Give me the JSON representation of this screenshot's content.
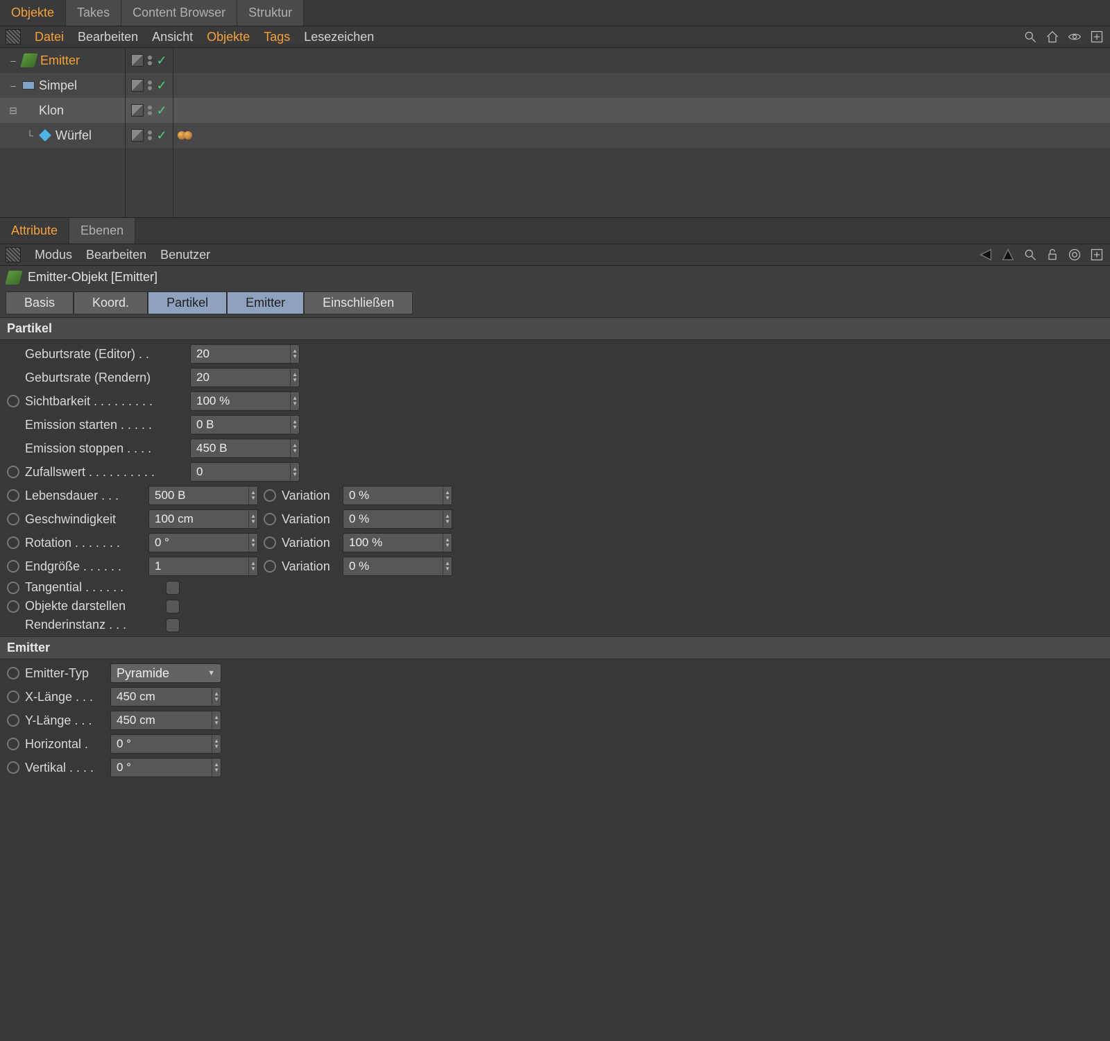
{
  "top_tabs": {
    "objekte": "Objekte",
    "takes": "Takes",
    "content": "Content Browser",
    "struktur": "Struktur"
  },
  "obj_menu": {
    "datei": "Datei",
    "bearbeiten": "Bearbeiten",
    "ansicht": "Ansicht",
    "objekte": "Objekte",
    "tags": "Tags",
    "lesezeichen": "Lesezeichen"
  },
  "tree": {
    "emitter": "Emitter",
    "simpel": "Simpel",
    "klon": "Klon",
    "wuerfel": "Würfel"
  },
  "attr_tabs": {
    "attribute": "Attribute",
    "ebenen": "Ebenen"
  },
  "attr_menu": {
    "modus": "Modus",
    "bearbeiten": "Bearbeiten",
    "benutzer": "Benutzer"
  },
  "attr_header": "Emitter-Objekt [Emitter]",
  "sub_tabs": {
    "basis": "Basis",
    "koord": "Koord.",
    "partikel": "Partikel",
    "emitter": "Emitter",
    "einschl": "Einschließen"
  },
  "sections": {
    "partikel": "Partikel",
    "emitter": "Emitter"
  },
  "labels": {
    "birth_editor": "Geburtsrate (Editor) . .",
    "birth_render": "Geburtsrate (Rendern)",
    "sichtbarkeit": "Sichtbarkeit . . . . . . . . .",
    "emission_start": "Emission starten . . . . .",
    "emission_stop": "Emission stoppen . . . .",
    "zufall": "Zufallswert . . . . . . . . . .",
    "lebensdauer": "Lebensdauer . . .",
    "geschwindigkeit": "Geschwindigkeit",
    "rotation": "Rotation . . . . . . .",
    "endgroesse": "Endgröße . . . . . .",
    "variation": "Variation",
    "tangential": "Tangential  . . . . . .",
    "objdarst": "Objekte darstellen",
    "renderinst": "Renderinstanz . . .",
    "emitter_typ": "Emitter-Typ",
    "xlaenge": "X-Länge . . .",
    "ylaenge": "Y-Länge . . .",
    "horizontal": "Horizontal .",
    "vertikal": "Vertikal . . . ."
  },
  "values": {
    "birth_editor": "20",
    "birth_render": "20",
    "sichtbarkeit": "100 %",
    "emission_start": "0 B",
    "emission_stop": "450 B",
    "zufall": "0",
    "lebensdauer": "500 B",
    "lebensdauer_var": "0 %",
    "geschwindigkeit": "100 cm",
    "geschwindigkeit_var": "0 %",
    "rotation": "0 °",
    "rotation_var": "100 %",
    "endgroesse": "1",
    "endgroesse_var": "0 %",
    "emitter_typ": "Pyramide",
    "xlaenge": "450 cm",
    "ylaenge": "450 cm",
    "horizontal": "0 °",
    "vertikal": "0 °"
  }
}
